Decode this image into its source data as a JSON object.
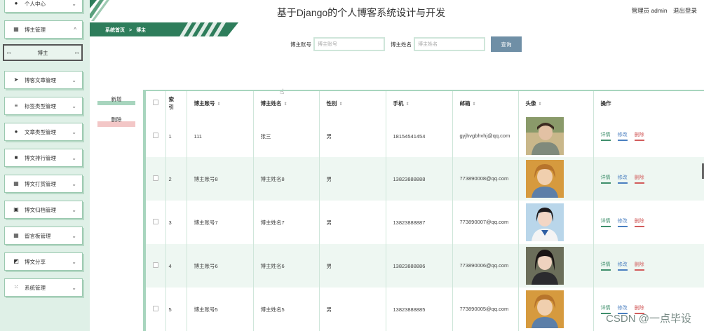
{
  "sidebar": {
    "items": [
      {
        "label": "个人中心",
        "icon": "user-icon"
      },
      {
        "label": "博主管理",
        "icon": "grid-icon",
        "expanded": true
      },
      {
        "label": "博客文章管理",
        "icon": "send-icon"
      },
      {
        "label": "标签类型管理",
        "icon": "list-icon"
      },
      {
        "label": "文章类型管理",
        "icon": "user-icon"
      },
      {
        "label": "博文排行管理",
        "icon": "briefcase-icon"
      },
      {
        "label": "博文打赏管理",
        "icon": "grid-icon"
      },
      {
        "label": "博文归档管理",
        "icon": "trash-icon"
      },
      {
        "label": "留言板管理",
        "icon": "grid-icon"
      },
      {
        "label": "博文分享",
        "icon": "share-icon"
      },
      {
        "label": "系统管理",
        "icon": "apps-icon"
      }
    ],
    "submenu_label": "博主"
  },
  "header": {
    "title": "基于Django的个人博客系统设计与开发",
    "user_label": "管理员 admin",
    "logout_label": "退出登录"
  },
  "breadcrumb": {
    "home": "系统首页",
    "separator": ">",
    "current": "博主"
  },
  "search": {
    "account_label": "博主账号",
    "account_placeholder": "博主账号",
    "name_label": "博主姓名",
    "name_placeholder": "博主姓名",
    "query_label": "查询"
  },
  "actions": {
    "add_label": "新增",
    "delete_label": "删除"
  },
  "table": {
    "headers": {
      "index": "索引",
      "account": "博主账号",
      "name": "博主姓名",
      "gender": "性别",
      "phone": "手机",
      "email": "邮箱",
      "avatar": "头像",
      "ops": "操作"
    },
    "rows": [
      {
        "index": "1",
        "account": "111",
        "name": "张三",
        "gender": "男",
        "phone": "18154541454",
        "email": "gyjhvgbhvhj@qq.com"
      },
      {
        "index": "2",
        "account": "博主账号8",
        "name": "博主姓名8",
        "gender": "男",
        "phone": "13823888888",
        "email": "773890008@qq.com"
      },
      {
        "index": "3",
        "account": "博主账号7",
        "name": "博主姓名7",
        "gender": "男",
        "phone": "13823888887",
        "email": "773890007@qq.com"
      },
      {
        "index": "4",
        "account": "博主账号6",
        "name": "博主姓名6",
        "gender": "男",
        "phone": "13823888886",
        "email": "773890006@qq.com"
      },
      {
        "index": "5",
        "account": "博主账号5",
        "name": "博主姓名5",
        "gender": "男",
        "phone": "13823888885",
        "email": "773890005@qq.com"
      }
    ],
    "row_actions": {
      "detail": "详情",
      "edit": "修改",
      "delete": "删除"
    }
  },
  "watermark": "CSDN @一点毕设",
  "colors": {
    "sidebar_bg": "#dff0e7",
    "accent_green": "#3f8f6c",
    "banner_green": "#2e7d5b",
    "query_button": "#6f8fa6"
  }
}
